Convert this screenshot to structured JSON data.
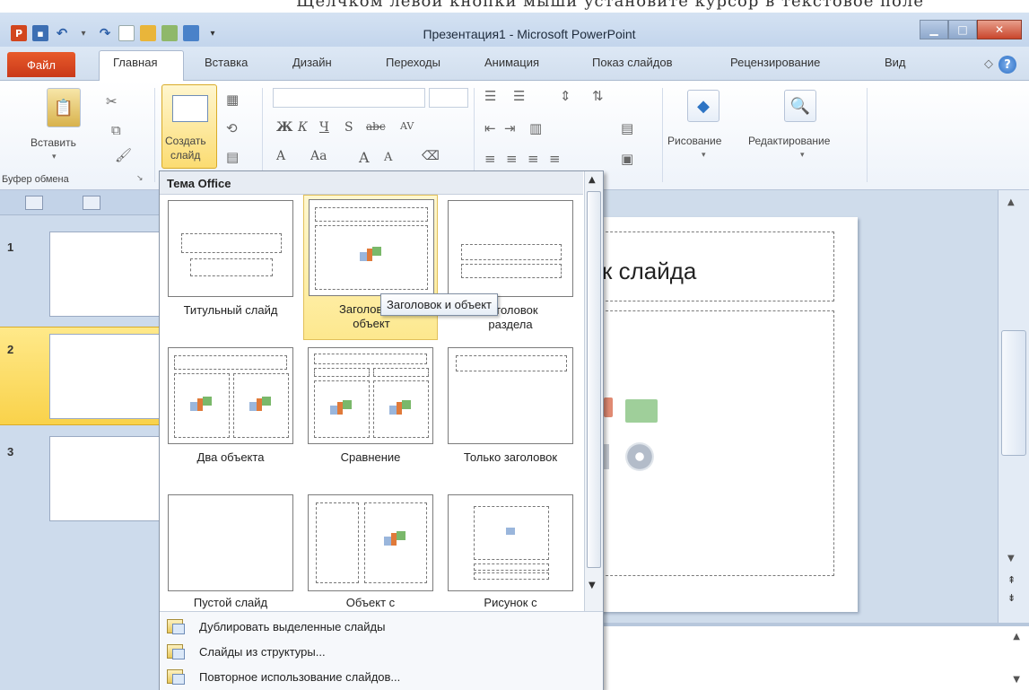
{
  "window": {
    "title": "Презентация1 - Microsoft PowerPoint",
    "top_strip_text": "Щелчком левой кнопки мыши установите курсор в текстовое поле"
  },
  "ribbon_tabs": [
    {
      "label": "Файл",
      "name": "tab-file"
    },
    {
      "label": "Главная",
      "name": "tab-home",
      "active": true
    },
    {
      "label": "Вставка",
      "name": "tab-insert"
    },
    {
      "label": "Дизайн",
      "name": "tab-design"
    },
    {
      "label": "Переходы",
      "name": "tab-transitions"
    },
    {
      "label": "Анимация",
      "name": "tab-animation"
    },
    {
      "label": "Показ слайдов",
      "name": "tab-slideshow"
    },
    {
      "label": "Рецензирование",
      "name": "tab-review"
    },
    {
      "label": "Вид",
      "name": "tab-view"
    }
  ],
  "ribbon": {
    "paste_label": "Вставить",
    "new_slide_label_1": "Создать",
    "new_slide_label_2": "слайд",
    "clipboard_group": "Буфер обмена",
    "drawing_label": "Рисование",
    "editing_label": "Редактирование"
  },
  "slides_panel": {
    "numbers": [
      "1",
      "2",
      "3"
    ],
    "selected": "2"
  },
  "slide": {
    "title_text": "к слайда"
  },
  "gallery": {
    "header": "Тема Office",
    "layouts": [
      {
        "name": "Титульный слайд",
        "line2": ""
      },
      {
        "name": "Заголовок и",
        "line2": "объект",
        "selected": true
      },
      {
        "name": "Заголовок",
        "line2": "раздела"
      },
      {
        "name": "Два объекта",
        "line2": ""
      },
      {
        "name": "Сравнение",
        "line2": ""
      },
      {
        "name": "Только заголовок",
        "line2": ""
      },
      {
        "name": "Пустой слайд",
        "line2": ""
      },
      {
        "name": "Объект с",
        "line2": ""
      },
      {
        "name": "Рисунок с",
        "line2": ""
      }
    ],
    "tooltip": "Заголовок и объект",
    "commands": [
      "Дублировать выделенные слайды",
      "Слайды из структуры...",
      "Повторное использование слайдов..."
    ]
  },
  "colors": {
    "file_tab": "#d2461e",
    "selection": "#fde88e",
    "accent_blue": "#2c6fc5"
  }
}
